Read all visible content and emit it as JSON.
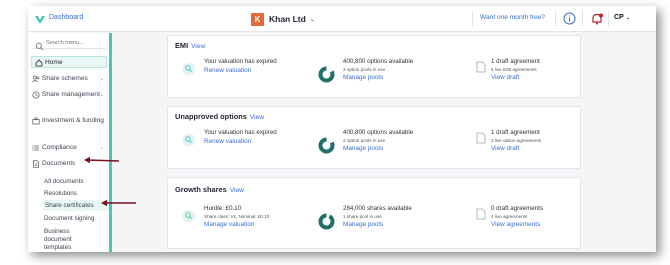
{
  "topbar": {
    "dashboard_label": "Dashboard",
    "company_initial": "K",
    "company_name": "Khan Ltd",
    "trial_link": "Want one month free?",
    "user_initials": "CP"
  },
  "sidebar": {
    "search_placeholder": "Search menu...",
    "items": [
      {
        "label": "Home",
        "icon": "home-icon"
      },
      {
        "label": "Share schemes",
        "icon": "people-icon"
      },
      {
        "label": "Share management",
        "icon": "clock-icon"
      },
      {
        "label": "Investment & funding",
        "icon": "briefcase-icon"
      },
      {
        "label": "Compliance",
        "icon": "list-icon"
      },
      {
        "label": "Documents",
        "icon": "document-icon"
      }
    ],
    "documents_sub": [
      "All documents",
      "Resolutions",
      "Share certificates",
      "Document signing",
      "Business document templates"
    ]
  },
  "cards": [
    {
      "title": "EMI",
      "view": "View",
      "valuation_line": "Your valuation has expired",
      "valuation_link": "Renew valuation",
      "options_line": "400,800 options available",
      "options_sub": "3 option pools in use",
      "options_link": "Manage pools",
      "draft_line": "1 draft agreement",
      "draft_sub": "6 live EMI agreements",
      "draft_link": "View draft"
    },
    {
      "title": "Unapproved options",
      "view": "View",
      "valuation_line": "Your valuation has expired",
      "valuation_link": "Renew valuation",
      "options_line": "400,800 options available",
      "options_sub": "2 option pools in use",
      "options_link": "Manage pools",
      "draft_line": "1 draft agreement",
      "draft_sub": "2 live option agreements",
      "draft_link": "View draft"
    },
    {
      "title": "Growth shares",
      "view": "View",
      "valuation_line": "Hurdle: £0.10",
      "valuation_sub": "Share class: Vs, Nominal: £0.10",
      "valuation_link": "Manage valuation",
      "options_line": "284,000 shares available",
      "options_sub": "1 share pool in use",
      "options_link": "Manage pools",
      "draft_line": "0 draft agreements",
      "draft_sub": "4 live agreements",
      "draft_link": "View agreements"
    }
  ],
  "colors": {
    "accent": "#4cc6b4",
    "link": "#3b6fd1",
    "donut": "#1f6f6a",
    "arrow": "#7a1020",
    "company_badge": "#e26a3a"
  }
}
